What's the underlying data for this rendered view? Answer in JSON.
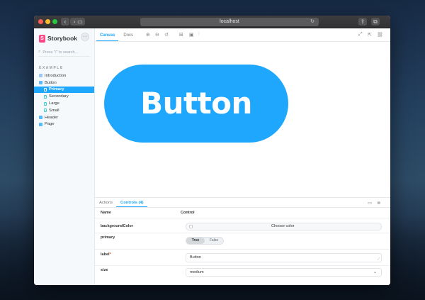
{
  "browser": {
    "url": "localhost"
  },
  "sidebar": {
    "logo": "Storybook",
    "more_label": "···",
    "search_placeholder": "Press \"/\" to search...",
    "section_title": "EXAMPLE",
    "items": [
      {
        "label": "Introduction",
        "type": "folder",
        "level": 0,
        "active": false
      },
      {
        "label": "Button",
        "type": "component",
        "level": 0,
        "active": false
      },
      {
        "label": "Primary",
        "type": "story",
        "level": 1,
        "active": true
      },
      {
        "label": "Secondary",
        "type": "story",
        "level": 1,
        "active": false
      },
      {
        "label": "Large",
        "type": "story",
        "level": 1,
        "active": false
      },
      {
        "label": "Small",
        "type": "story",
        "level": 1,
        "active": false
      },
      {
        "label": "Header",
        "type": "component",
        "level": 0,
        "active": false
      },
      {
        "label": "Page",
        "type": "component",
        "level": 0,
        "active": false
      }
    ]
  },
  "toolbar": {
    "tabs": [
      {
        "label": "Canvas",
        "active": true
      },
      {
        "label": "Docs",
        "active": false
      }
    ]
  },
  "preview": {
    "button_label": "Button",
    "button_color": "#1ea7fd"
  },
  "addons": {
    "tabs": [
      {
        "label": "Actions",
        "active": false
      },
      {
        "label": "Controls (4)",
        "active": true
      }
    ],
    "columns": {
      "name": "Name",
      "control": "Control"
    },
    "rows": {
      "backgroundColor": {
        "name": "backgroundColor",
        "button": "Choose color"
      },
      "primary": {
        "name": "primary",
        "true_label": "True",
        "false_label": "False",
        "value": true
      },
      "label": {
        "name": "label",
        "required_mark": "*",
        "value": "Button"
      },
      "size": {
        "name": "size",
        "value": "medium"
      }
    }
  },
  "colors": {
    "accent": "#1ea7fd",
    "storybook_pink": "#ff4785"
  }
}
